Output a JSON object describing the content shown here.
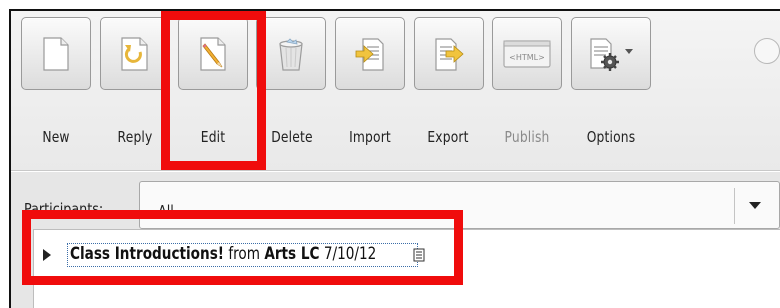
{
  "toolbar": {
    "buttons": [
      {
        "label": "New",
        "icon": "new-document-icon",
        "enabled": true
      },
      {
        "label": "Reply",
        "icon": "reply-icon",
        "enabled": true
      },
      {
        "label": "Edit",
        "icon": "edit-pencil-icon",
        "enabled": true
      },
      {
        "label": "Delete",
        "icon": "trash-can-icon",
        "enabled": true
      },
      {
        "label": "Import",
        "icon": "import-icon",
        "enabled": true
      },
      {
        "label": "Export",
        "icon": "export-icon",
        "enabled": true
      },
      {
        "label": "Publish",
        "icon": "html-icon",
        "enabled": false,
        "icon_text": "<HTML>"
      },
      {
        "label": "Options",
        "icon": "options-gear-icon",
        "enabled": true
      }
    ]
  },
  "filter": {
    "label": "Participants:",
    "selected": "All"
  },
  "tree": {
    "item": {
      "title": "Class Introductions!",
      "from_word": "from",
      "author": "Arts LC",
      "date": "7/10/12"
    }
  },
  "highlight_color": "#f00c0c"
}
